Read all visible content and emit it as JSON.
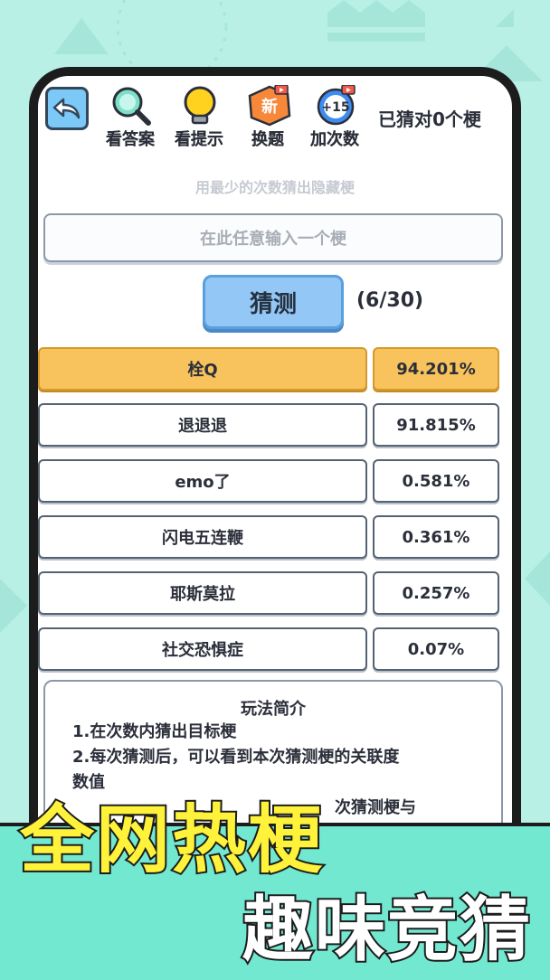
{
  "toolbar": {
    "view_answer": "看答案",
    "view_hint": "看提示",
    "change_question": "换题",
    "change_badge": "新",
    "add_attempts": "加次数",
    "add_badge": "+15",
    "guessed_status": "已猜对0个梗"
  },
  "instruction": "用最少的次数猜出隐藏梗",
  "input": {
    "placeholder": "在此任意输入一个梗"
  },
  "guess_button": "猜测",
  "counter": "(6/30)",
  "results": [
    {
      "word": "栓Q",
      "pct": "94.201%"
    },
    {
      "word": "退退退",
      "pct": "91.815%"
    },
    {
      "word": "emo了",
      "pct": "0.581%"
    },
    {
      "word": "闪电五连鞭",
      "pct": "0.361%"
    },
    {
      "word": "耶斯莫拉",
      "pct": "0.257%"
    },
    {
      "word": "社交恐惧症",
      "pct": "0.07%"
    }
  ],
  "rules": {
    "title": "玩法简介",
    "line1": "1.在次数内猜出目标梗",
    "line2": "2.每次猜测后，可以看到本次猜测梗的关联度",
    "line3": "数值",
    "line4": "次猜测梗与"
  },
  "slogan": {
    "line1": "全网热梗",
    "line2": "趣味竞猜"
  },
  "colors": {
    "background": "#b8f0e6",
    "best_row": "#f8c35c",
    "button": "#93c7f5",
    "slogan_yellow": "#fff23a"
  }
}
